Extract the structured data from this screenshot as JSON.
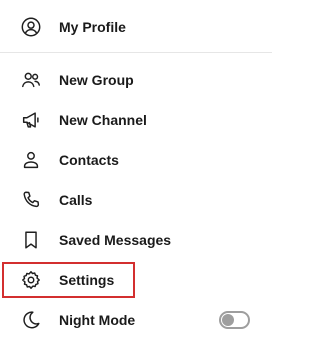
{
  "menu": {
    "profile": {
      "label": "My Profile",
      "icon": "user-circle-icon"
    },
    "items": [
      {
        "label": "New Group",
        "icon": "users-icon"
      },
      {
        "label": "New Channel",
        "icon": "megaphone-icon"
      },
      {
        "label": "Contacts",
        "icon": "user-icon"
      },
      {
        "label": "Calls",
        "icon": "phone-icon"
      },
      {
        "label": "Saved Messages",
        "icon": "bookmark-icon"
      },
      {
        "label": "Settings",
        "icon": "gear-icon"
      },
      {
        "label": "Night Mode",
        "icon": "moon-icon"
      }
    ],
    "night_mode_on": false
  },
  "colors": {
    "highlight": "#d32f2f",
    "text": "#1a1a1a",
    "toggle_off": "#9e9e9e"
  }
}
